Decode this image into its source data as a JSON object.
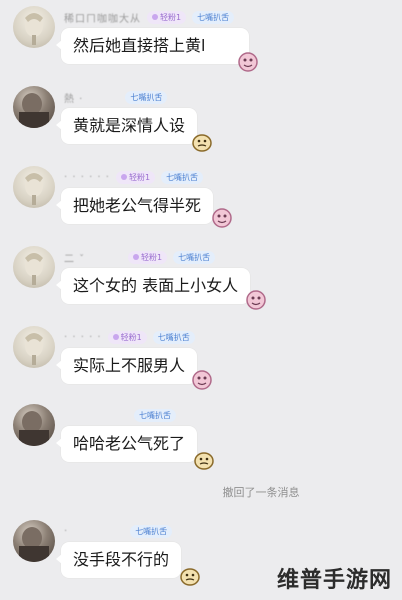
{
  "messages": [
    {
      "nick": "稀口ㄇ咖咖大从",
      "fan_badge": "轻粉1",
      "group_badge": "七嘴扒舌",
      "text": "然后她直接搭上黄l",
      "avatar": "light"
    },
    {
      "nick": "熱  ·",
      "fan_badge": "",
      "group_badge": "七嘴扒舌",
      "text": "黄就是深情人设",
      "avatar": "dark"
    },
    {
      "nick": "· · ·  · ·  ·",
      "fan_badge": "轻粉1",
      "group_badge": "七嘴扒舌",
      "text": "把她老公气得半死",
      "avatar": "light"
    },
    {
      "nick": "二   ˇ",
      "fan_badge": "轻粉1",
      "group_badge": "七嘴扒舌",
      "text": "这个女的 表面上小女人",
      "avatar": "light"
    },
    {
      "nick": "· · ·  · ·",
      "fan_badge": "轻粉1",
      "group_badge": "七嘴扒舌",
      "text": "实际上不服男人",
      "avatar": "light"
    },
    {
      "nick": "",
      "fan_badge": "",
      "group_badge": "七嘴扒舌",
      "text": "哈哈老公气死了",
      "avatar": "dark"
    },
    {
      "nick": "·",
      "fan_badge": "",
      "group_badge": "七嘴扒舌",
      "text": "没手段不行的",
      "avatar": "dark"
    }
  ],
  "recall_notice": "撤回了一条消息",
  "watermark": "维普手游网",
  "icons": {
    "sticker_pink": "pink-sticker-icon",
    "sticker_gold": "gold-sticker-icon"
  }
}
